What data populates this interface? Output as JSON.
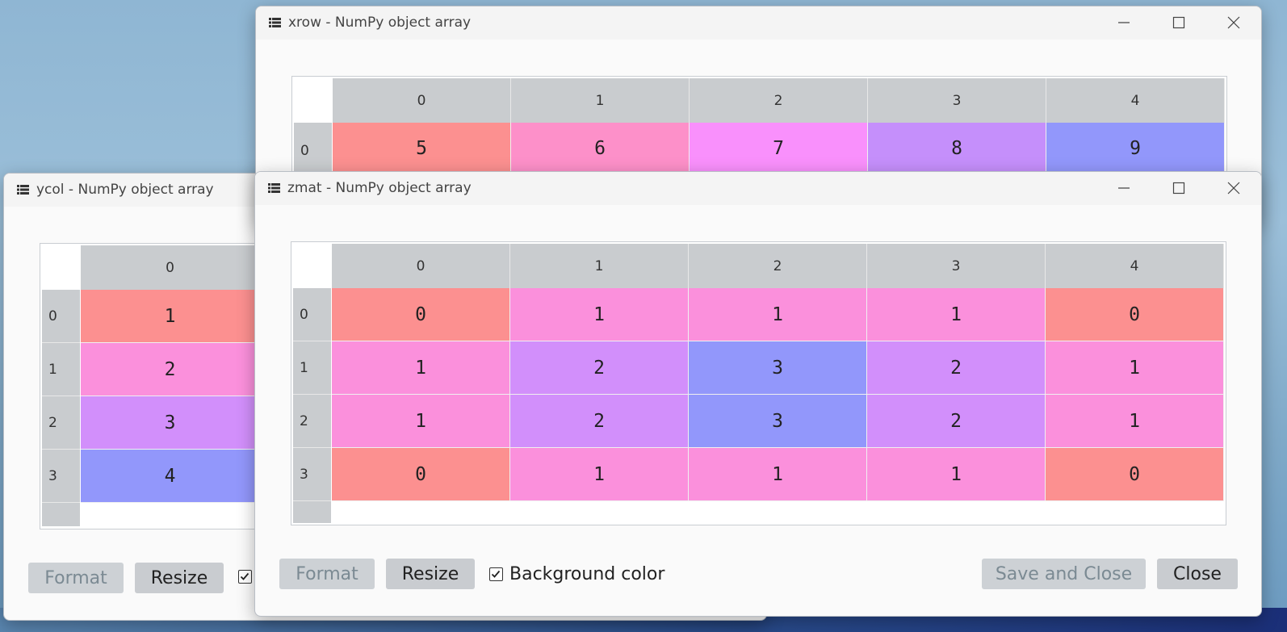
{
  "colors": {
    "c0": "#fc9090",
    "c1": "#fb90dc",
    "c2": "#d28ffb",
    "c3": "#9297fb",
    "c_xrow_1": "#fd90c9",
    "c_xrow_2": "#f990fc",
    "c_xrow_3": "#c58ffb"
  },
  "windows": {
    "xrow": {
      "title": "xrow - NumPy object array",
      "col_headers": [
        "0",
        "1",
        "2",
        "3",
        "4"
      ],
      "row_headers": [
        "0"
      ],
      "rows": [
        [
          "5",
          "6",
          "7",
          "8",
          "9"
        ]
      ]
    },
    "ycol": {
      "title": "ycol - NumPy object array",
      "col_headers": [
        "0"
      ],
      "row_headers": [
        "0",
        "1",
        "2",
        "3"
      ],
      "rows": [
        [
          "1"
        ],
        [
          "2"
        ],
        [
          "3"
        ],
        [
          "4"
        ]
      ],
      "buttons": {
        "format": "Format",
        "resize": "Resize"
      }
    },
    "zmat": {
      "title": "zmat - NumPy object array",
      "col_headers": [
        "0",
        "1",
        "2",
        "3",
        "4"
      ],
      "row_headers": [
        "0",
        "1",
        "2",
        "3"
      ],
      "rows": [
        [
          "0",
          "1",
          "1",
          "1",
          "0"
        ],
        [
          "1",
          "2",
          "3",
          "2",
          "1"
        ],
        [
          "1",
          "2",
          "3",
          "2",
          "1"
        ],
        [
          "0",
          "1",
          "1",
          "1",
          "0"
        ]
      ],
      "buttons": {
        "format": "Format",
        "resize": "Resize",
        "background_color": "Background color",
        "background_color_checked": true,
        "save_and_close": "Save and Close",
        "close": "Close"
      }
    }
  }
}
